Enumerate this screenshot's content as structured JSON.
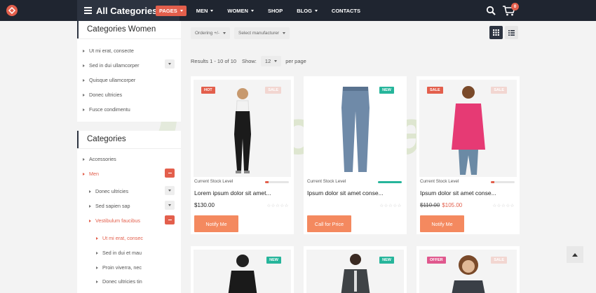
{
  "topbar": {
    "all_categories": "All Categories",
    "nav": [
      "PAGES",
      "MEN",
      "WOMEN",
      "SHOP",
      "BLOG",
      "CONTACTS"
    ],
    "cart_count": "0"
  },
  "watermark": "Joomla.id",
  "sidebar": {
    "women": {
      "title": "Categories Women",
      "items": [
        "Ut mi erat, consecte",
        "Sed in dui ullamcorper",
        "Quisque ullamcorper",
        "Donec ultricies",
        "Fusce condimentu"
      ]
    },
    "categories": {
      "title": "Categories",
      "items": [
        "Accessories",
        "Men",
        "Donec ultricies",
        "Sed sapien sap",
        "Vestibulum faucibus",
        "Ut mi erat, consec",
        "Sed in dui et mau",
        "Proin viverra, nec",
        "Donec ultricies tin"
      ]
    }
  },
  "toolbar": {
    "ordering": "Ordering +/-",
    "manufacturer": "Select manufacturer",
    "results": "Results 1 - 10 of 10",
    "show_label": "Show:",
    "per_page_value": "12",
    "per_page_label": "per page"
  },
  "products": [
    {
      "badge_left": "HOT",
      "badge_right": "SALE",
      "stock_label": "Current Stock Level",
      "stock_level": 0.15,
      "stock_color": "#e35f4c",
      "title": "Lorem ipsum dolor sit amet...",
      "price": "$130.00",
      "old_price": "",
      "button": "Notify Me",
      "stars": "☆☆☆☆☆"
    },
    {
      "badge_left": "",
      "badge_right": "NEW",
      "stock_label": "Current Stock Level",
      "stock_level": 1.0,
      "stock_color": "#26b59b",
      "title": "Ipsum dolor sit amet conse...",
      "price": "",
      "old_price": "",
      "button": "Call for Price",
      "stars": "☆☆☆☆☆"
    },
    {
      "badge_left": "SALE",
      "badge_right": "SALE",
      "stock_label": "Current Stock Level",
      "stock_level": 0.15,
      "stock_color": "#e35f4c",
      "title": "Ipsum dolor sit amet conse...",
      "price": "$105.00",
      "old_price": "$110.00",
      "button": "Notify Me",
      "stars": "☆☆☆☆☆"
    }
  ],
  "products_row2": [
    {
      "badge_right": "NEW"
    },
    {
      "badge_right": "NEW"
    },
    {
      "badge_left": "OFFER",
      "badge_right": "SALE"
    }
  ]
}
